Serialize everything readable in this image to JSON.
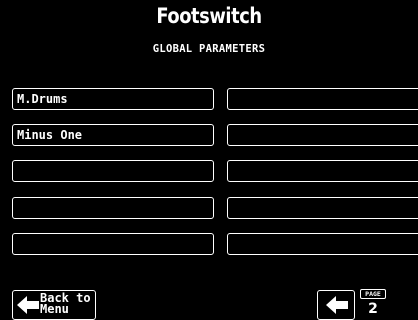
{
  "header": {
    "title": "Footswitch",
    "subtitle": "GLOBAL PARAMETERS"
  },
  "slots": {
    "left": [
      "M.Drums",
      "Minus One",
      "",
      "",
      ""
    ],
    "right": [
      "",
      "",
      "",
      "",
      ""
    ]
  },
  "footer": {
    "back_label": "Back to\nMenu",
    "page_tag": "PAGE",
    "page_number": "2"
  },
  "icons": {
    "back": "left-arrow-icon",
    "prev": "left-arrow-icon"
  },
  "colors": {
    "background": "#000000",
    "foreground": "#ffffff"
  }
}
